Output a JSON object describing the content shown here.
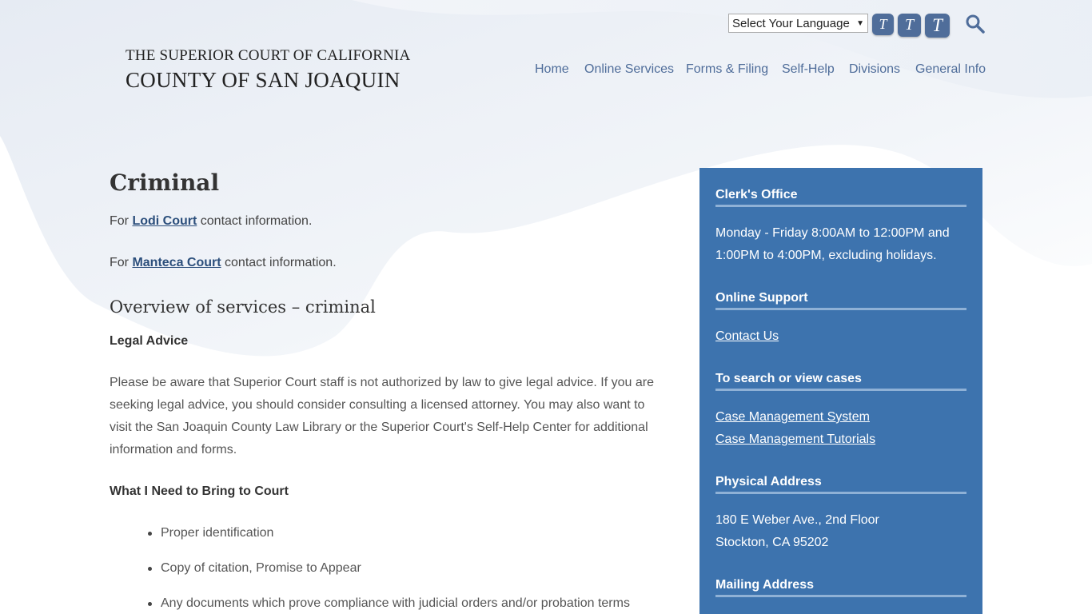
{
  "header": {
    "logo_line1": "THE SUPERIOR COURT OF CALIFORNIA",
    "logo_line2": "COUNTY OF SAN JOAQUIN",
    "language_select": "Select Your Language",
    "text_size_buttons": [
      "T",
      "T",
      "T"
    ],
    "search_icon": "search-icon",
    "nav": [
      "Home",
      "Online Services",
      "Forms & Filing",
      "Self-Help",
      "Divisions",
      "General Info"
    ]
  },
  "main": {
    "title": "Criminal",
    "lodi": {
      "prefix": "For ",
      "link": "Lodi Court",
      "suffix": " contact information."
    },
    "manteca": {
      "prefix": "For ",
      "link": "Manteca Court",
      "suffix": " contact information."
    },
    "overview_heading": "Overview of services – criminal",
    "legal_advice_heading": "Legal Advice",
    "legal_advice_text": "Please be aware that Superior Court staff is not authorized by law to give legal advice. If you are seeking legal advice, you should consider consulting a licensed attorney.  You may also want to visit the San Joaquin County Law Library or the Superior Court's Self-Help Center for additional information and forms.",
    "bring_heading": "What I Need to Bring to Court",
    "bring_items": [
      "Proper identification",
      "Copy of citation, Promise to Appear",
      "Any documents which prove compliance with judicial orders and/or probation terms"
    ]
  },
  "sidebar": {
    "clerk_heading": "Clerk's Office",
    "clerk_hours_1": "Monday - Friday 8:00AM to 12:00PM and",
    "clerk_hours_2": "1:00PM to 4:00PM, excluding holidays.",
    "support_heading": "Online Support",
    "contact_link": "Contact Us",
    "cases_heading": "To search or view cases",
    "cms_link": "Case Management System",
    "tutorials_link": "Case Management Tutorials",
    "physical_heading": "Physical Address",
    "address_1": "180 E Weber Ave., 2nd Floor",
    "address_2": "Stockton, CA 95202",
    "mailing_heading": "Mailing Address"
  },
  "colors": {
    "accent": "#4f6d9a",
    "sidebar": "#3d73ae",
    "link": "#2c4f7c"
  }
}
